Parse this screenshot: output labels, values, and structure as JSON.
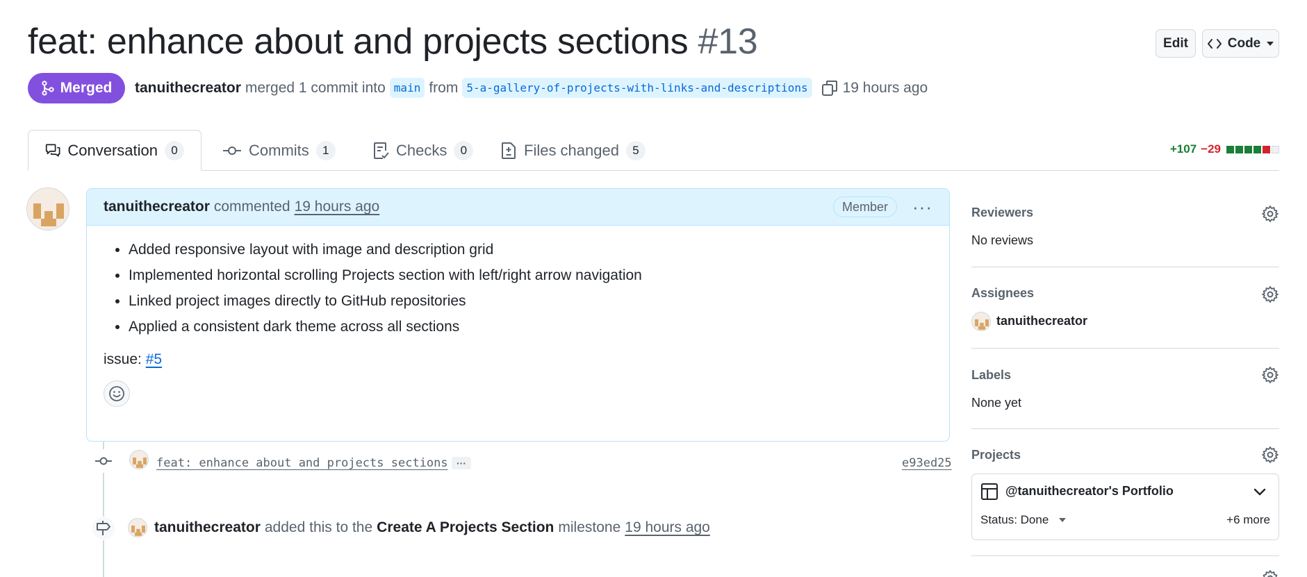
{
  "header": {
    "title": "feat: enhance about and projects sections",
    "number": "#13",
    "edit_label": "Edit",
    "code_label": "Code"
  },
  "status": {
    "badge_label": "Merged",
    "author": "tanuithecreator",
    "merged_text": "merged 1 commit into",
    "base_branch": "main",
    "from_text": "from",
    "head_branch": "5-a-gallery-of-projects-with-links-and-descriptions",
    "time": "19 hours ago"
  },
  "tabs": [
    {
      "label": "Conversation",
      "count": "0",
      "icon": "comment-discussion-icon"
    },
    {
      "label": "Commits",
      "count": "1",
      "icon": "git-commit-icon"
    },
    {
      "label": "Checks",
      "count": "0",
      "icon": "checklist-icon"
    },
    {
      "label": "Files changed",
      "count": "5",
      "icon": "file-diff-icon"
    }
  ],
  "diffstat": {
    "additions": "+107",
    "deletions": "−29"
  },
  "colors": {
    "merged": "#8250df",
    "add": "#1a7f37",
    "del": "#d1242f",
    "link": "#0969da",
    "header_bg": "#ddf4ff"
  },
  "comment": {
    "author": "tanuithecreator",
    "action": "commented",
    "time": "19 hours ago",
    "role": "Member",
    "bullets": [
      "Added responsive layout with image and description grid",
      "Implemented horizontal scrolling Projects section with left/right arrow navigation",
      "Linked project images directly to GitHub repositories",
      "Applied a consistent dark theme across all sections"
    ],
    "issue_label": "issue:",
    "issue_link": "#5"
  },
  "timeline": {
    "commit_message": "feat: enhance about and projects sections",
    "commit_ellipsis": "···",
    "commit_sha": "e93ed25",
    "milestone_author": "tanuithecreator",
    "milestone_text": "added this to the",
    "milestone_name": "Create A Projects Section",
    "milestone_word": "milestone",
    "milestone_time": "19 hours ago"
  },
  "sidebar": {
    "reviewers_title": "Reviewers",
    "reviewers_value": "No reviews",
    "assignees_title": "Assignees",
    "assignee": "tanuithecreator",
    "labels_title": "Labels",
    "labels_value": "None yet",
    "projects_title": "Projects",
    "project_name": "@tanuithecreator's Portfolio",
    "project_status": "Status: Done",
    "project_more": "+6 more"
  }
}
